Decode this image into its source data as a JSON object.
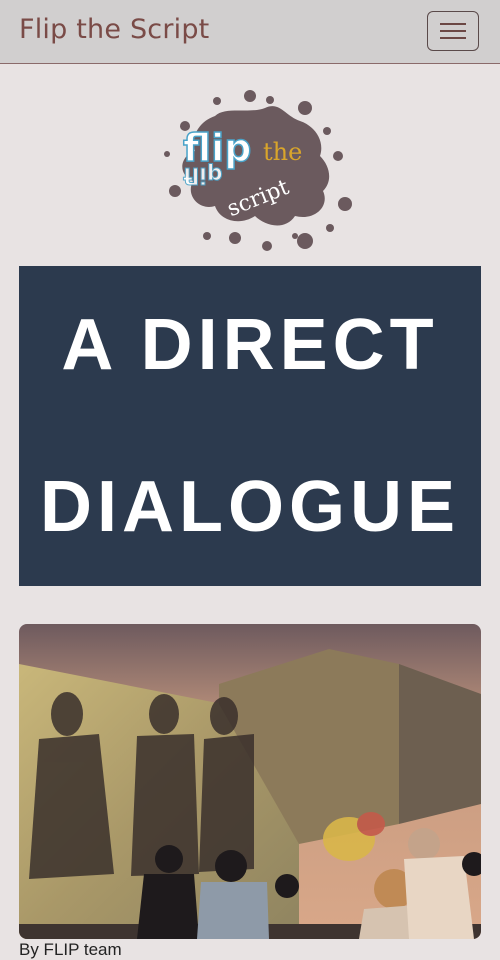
{
  "navbar": {
    "brand": "Flip the Script",
    "menu_icon": "hamburger-menu-icon"
  },
  "logo": {
    "word_flip": "flip",
    "word_the": "the",
    "word_script": "script",
    "splat_color": "#6b5a5e"
  },
  "banner": {
    "line1": "A DIRECT",
    "line2": "DIALOGUE",
    "background": "#2c3a4e"
  },
  "post": {
    "image_alt": "",
    "byline": "By FLIP team"
  }
}
